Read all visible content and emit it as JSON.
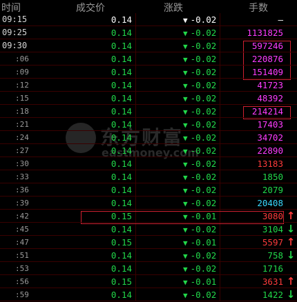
{
  "header": {
    "time": "时间",
    "price": "成交价",
    "change": "涨跌",
    "volume": "手数"
  },
  "watermark": {
    "cn": "东方财富",
    "en": "eastmoney.com"
  },
  "colors": {
    "up": "#ff3b3b",
    "down": "#22d84a",
    "white": "#ffffff",
    "magenta": "#ff3cff",
    "cyan": "#39d9ff"
  },
  "rows": [
    {
      "time": "09:15",
      "price": "0.14",
      "price_color": "white",
      "dir": "▼",
      "change": "-0.02",
      "change_color": "white",
      "volume": "—",
      "volume_color": "white",
      "arrow": ""
    },
    {
      "time": "09:25",
      "price": "0.14",
      "price_color": "down",
      "dir": "▼",
      "change": "-0.02",
      "change_color": "down",
      "volume": "1131825",
      "volume_color": "magenta",
      "arrow": ""
    },
    {
      "time": "09:30",
      "price": "0.14",
      "price_color": "down",
      "dir": "▼",
      "change": "-0.02",
      "change_color": "down",
      "volume": "597246",
      "volume_color": "magenta",
      "arrow": ""
    },
    {
      "time": ":06",
      "price": "0.14",
      "price_color": "down",
      "dir": "▼",
      "change": "-0.02",
      "change_color": "down",
      "volume": "220876",
      "volume_color": "magenta",
      "arrow": ""
    },
    {
      "time": ":09",
      "price": "0.14",
      "price_color": "down",
      "dir": "▼",
      "change": "-0.02",
      "change_color": "down",
      "volume": "151409",
      "volume_color": "magenta",
      "arrow": ""
    },
    {
      "time": ":12",
      "price": "0.14",
      "price_color": "down",
      "dir": "▼",
      "change": "-0.02",
      "change_color": "down",
      "volume": "41723",
      "volume_color": "magenta",
      "arrow": ""
    },
    {
      "time": ":15",
      "price": "0.14",
      "price_color": "down",
      "dir": "▼",
      "change": "-0.02",
      "change_color": "down",
      "volume": "48392",
      "volume_color": "magenta",
      "arrow": ""
    },
    {
      "time": ":18",
      "price": "0.14",
      "price_color": "down",
      "dir": "▼",
      "change": "-0.02",
      "change_color": "down",
      "volume": "214214",
      "volume_color": "magenta",
      "arrow": ""
    },
    {
      "time": ":21",
      "price": "0.14",
      "price_color": "down",
      "dir": "▼",
      "change": "-0.02",
      "change_color": "down",
      "volume": "17403",
      "volume_color": "magenta",
      "arrow": ""
    },
    {
      "time": ":24",
      "price": "0.14",
      "price_color": "down",
      "dir": "▼",
      "change": "-0.02",
      "change_color": "down",
      "volume": "34702",
      "volume_color": "magenta",
      "arrow": ""
    },
    {
      "time": ":27",
      "price": "0.14",
      "price_color": "down",
      "dir": "▼",
      "change": "-0.02",
      "change_color": "down",
      "volume": "22890",
      "volume_color": "magenta",
      "arrow": ""
    },
    {
      "time": ":30",
      "price": "0.14",
      "price_color": "down",
      "dir": "▼",
      "change": "-0.02",
      "change_color": "down",
      "volume": "13183",
      "volume_color": "up",
      "arrow": ""
    },
    {
      "time": ":33",
      "price": "0.14",
      "price_color": "down",
      "dir": "▼",
      "change": "-0.02",
      "change_color": "down",
      "volume": "1850",
      "volume_color": "down",
      "arrow": ""
    },
    {
      "time": ":36",
      "price": "0.14",
      "price_color": "down",
      "dir": "▼",
      "change": "-0.02",
      "change_color": "down",
      "volume": "2079",
      "volume_color": "down",
      "arrow": ""
    },
    {
      "time": ":39",
      "price": "0.14",
      "price_color": "down",
      "dir": "▼",
      "change": "-0.02",
      "change_color": "down",
      "volume": "20408",
      "volume_color": "cyan",
      "arrow": ""
    },
    {
      "time": ":42",
      "price": "0.15",
      "price_color": "down",
      "dir": "▼",
      "change": "-0.01",
      "change_color": "down",
      "volume": "3080",
      "volume_color": "up",
      "arrow": "↑",
      "arrow_color": "up"
    },
    {
      "time": ":45",
      "price": "0.14",
      "price_color": "down",
      "dir": "▼",
      "change": "-0.02",
      "change_color": "down",
      "volume": "3104",
      "volume_color": "down",
      "arrow": "↓",
      "arrow_color": "down"
    },
    {
      "time": ":47",
      "price": "0.15",
      "price_color": "down",
      "dir": "▼",
      "change": "-0.01",
      "change_color": "down",
      "volume": "5597",
      "volume_color": "up",
      "arrow": "↑",
      "arrow_color": "up"
    },
    {
      "time": ":51",
      "price": "0.14",
      "price_color": "down",
      "dir": "▼",
      "change": "-0.02",
      "change_color": "down",
      "volume": "758",
      "volume_color": "down",
      "arrow": "↓",
      "arrow_color": "down"
    },
    {
      "time": ":53",
      "price": "0.14",
      "price_color": "down",
      "dir": "▼",
      "change": "-0.02",
      "change_color": "down",
      "volume": "1716",
      "volume_color": "down",
      "arrow": ""
    },
    {
      "time": ":56",
      "price": "0.15",
      "price_color": "down",
      "dir": "▼",
      "change": "-0.01",
      "change_color": "down",
      "volume": "3631",
      "volume_color": "up",
      "arrow": "↑",
      "arrow_color": "up"
    },
    {
      "time": ":59",
      "price": "0.14",
      "price_color": "down",
      "dir": "▼",
      "change": "-0.02",
      "change_color": "down",
      "volume": "1422",
      "volume_color": "down",
      "arrow": "↓",
      "arrow_color": "down"
    }
  ]
}
